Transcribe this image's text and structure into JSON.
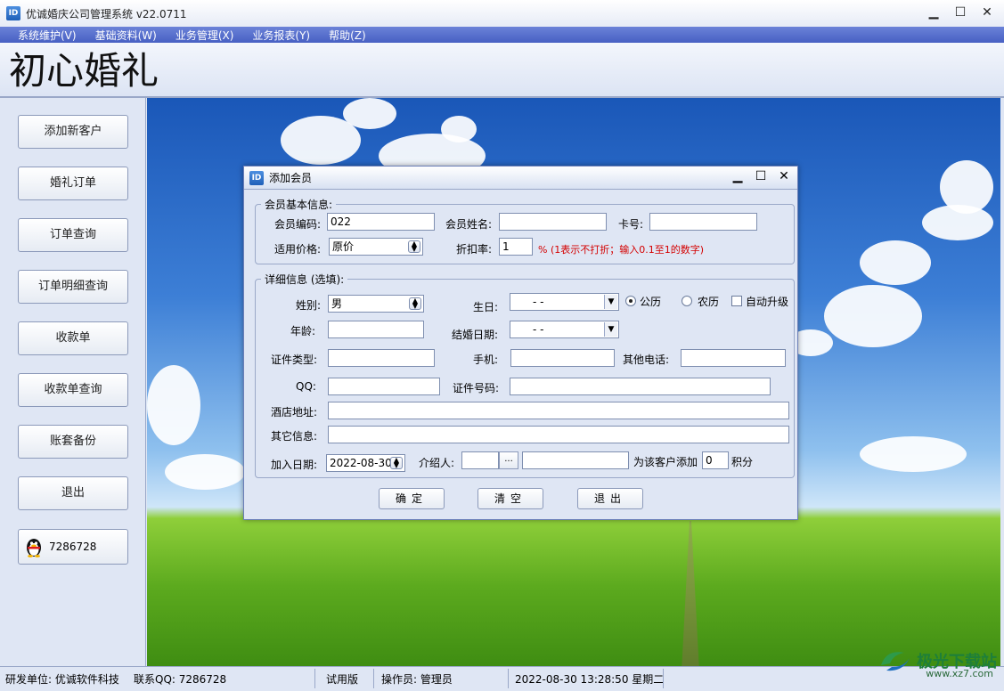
{
  "window": {
    "title": "优诚婚庆公司管理系统   v22.0711",
    "icon_text": "ID"
  },
  "menu": [
    "系统维护(V)",
    "基础资料(W)",
    "业务管理(X)",
    "业务报表(Y)",
    "帮助(Z)"
  ],
  "brand": "初心婚礼",
  "sidebar": {
    "buttons": [
      "添加新客户",
      "婚礼订单",
      "订单查询",
      "订单明细查询",
      "收款单",
      "收款单查询",
      "账套备份",
      "退出"
    ],
    "qq_number": "7286728"
  },
  "dialog": {
    "title": "添加会员",
    "basic_group": "会员基本信息:",
    "fields": {
      "member_code_label": "会员编码:",
      "member_code": "022",
      "member_name_label": "会员姓名:",
      "member_name": "",
      "card_label": "卡号:",
      "card": "",
      "price_label": "适用价格:",
      "price": "原价",
      "discount_label": "折扣率:",
      "discount": "1",
      "discount_hint": "% (1表示不打折；输入0.1至1的数字)"
    },
    "detail_group": "详细信息 (选填):",
    "detail": {
      "gender_label": "姓别:",
      "gender": "男",
      "birthday_label": "生日:",
      "birthday": "-  -",
      "calendar_solar": "公历",
      "calendar_lunar": "农历",
      "auto_upgrade": "自动升级",
      "age_label": "年龄:",
      "age": "",
      "wedding_date_label": "结婚日期:",
      "wedding_date": "-  -",
      "id_type_label": "证件类型:",
      "id_type": "",
      "phone_label": "手机:",
      "phone": "",
      "other_phone_label": "其他电话:",
      "other_phone": "",
      "qq_label": "QQ:",
      "qq": "",
      "id_no_label": "证件号码:",
      "id_no": "",
      "hotel_label": "酒店地址:",
      "hotel": "",
      "other_label": "其它信息:",
      "other": "",
      "join_date_label": "加入日期:",
      "join_date": "2022-08-30",
      "referrer_label": "介绍人:",
      "referrer": "",
      "referrer_name": "",
      "browse_label": "...",
      "points_prefix": "为该客户添加",
      "points": "0",
      "points_suffix": "积分"
    },
    "buttons": {
      "ok": "确定",
      "clear": "清空",
      "exit": "退出"
    }
  },
  "status": {
    "developer": "研发单位: 优诚软件科技",
    "contact": "联系QQ: 7286728",
    "edition": "试用版",
    "operator": "操作员: 管理员",
    "datetime": "2022-08-30 13:28:50 星期二"
  },
  "watermark": {
    "name": "极光下载站",
    "url": "www.xz7.com"
  }
}
